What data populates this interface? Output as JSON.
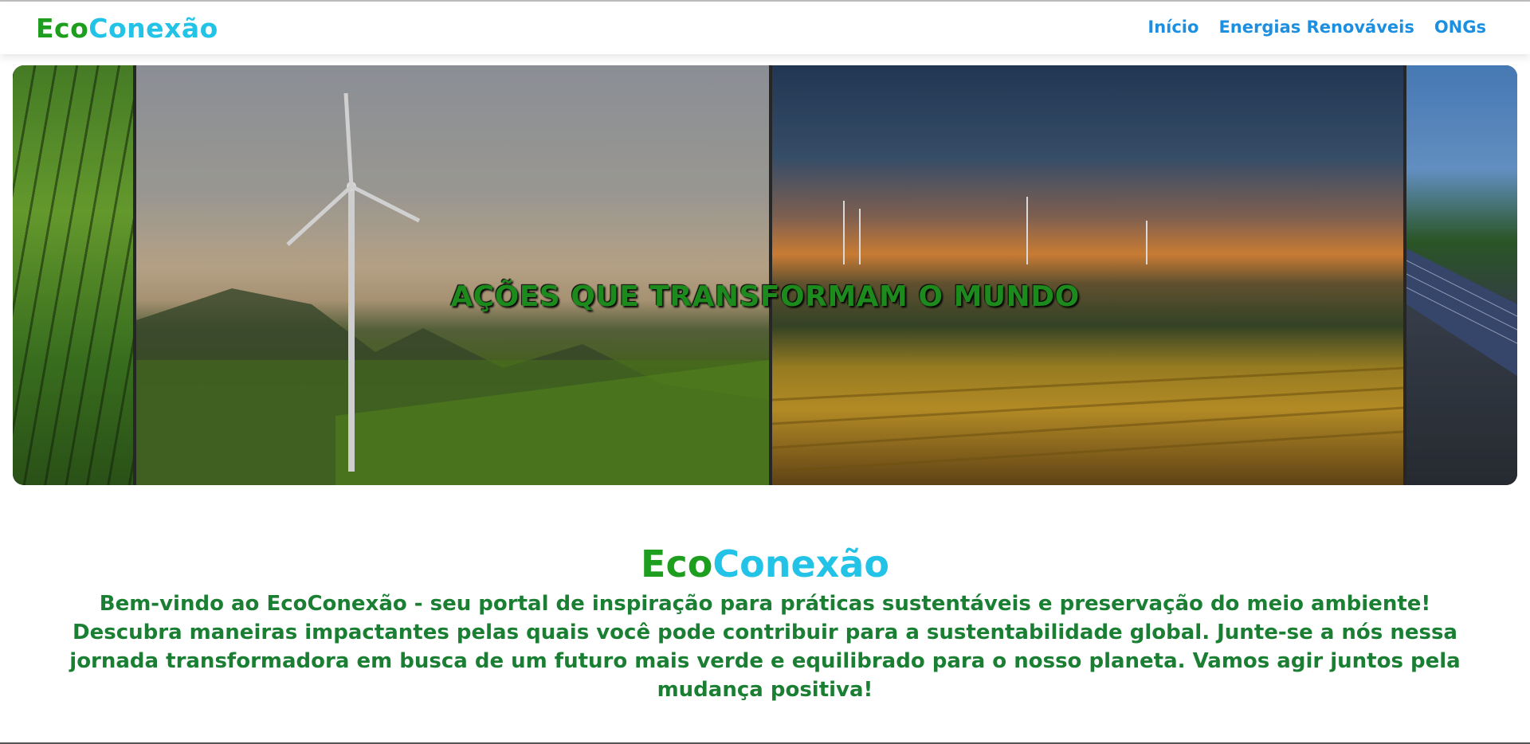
{
  "header": {
    "logo_part1": "Eco",
    "logo_part2": "Conexão",
    "nav": [
      "Início",
      "Energias Renováveis",
      "ONGs"
    ]
  },
  "hero": {
    "title": "AÇÕES QUE TRANSFORMAM O MUNDO",
    "panels": [
      "forest-image",
      "wind-turbine-image",
      "vineyard-wind-farm-image",
      "solar-panels-image"
    ]
  },
  "main": {
    "title_part1": "Eco",
    "title_part2": "Conexão",
    "intro": "Bem-vindo ao EcoConexão - seu portal de inspiração para práticas sustentáveis e preservação do meio ambiente! Descubra maneiras impactantes pelas quais você pode contribuir para a sustentabilidade global. Junte-se a nós nessa jornada transformadora em busca de um futuro mais verde e equilibrado para o nosso planeta. Vamos agir juntos pela mudança positiva!"
  },
  "colors": {
    "brand_green": "#1e9e1e",
    "brand_cyan": "#22c3e6",
    "nav_blue": "#1d8fe0",
    "text_green": "#1a7f33"
  }
}
